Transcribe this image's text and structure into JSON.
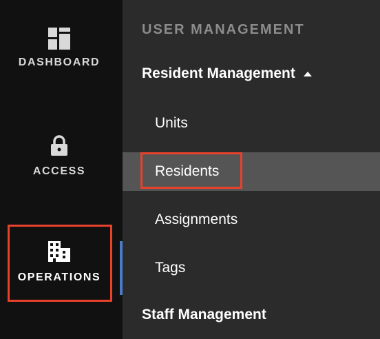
{
  "rail": {
    "items": [
      {
        "label": "DASHBOARD",
        "icon": "dashboard-icon"
      },
      {
        "label": "ACCESS",
        "icon": "lock-icon"
      },
      {
        "label": "OPERATIONS",
        "icon": "building-icon"
      }
    ],
    "active": "OPERATIONS"
  },
  "panel": {
    "section_title": "USER MANAGEMENT",
    "groups": [
      {
        "label": "Resident Management",
        "expanded": true,
        "items": [
          "Units",
          "Residents",
          "Assignments",
          "Tags"
        ],
        "selected": "Residents"
      },
      {
        "label": "Staff Management"
      }
    ]
  },
  "colors": {
    "rail_bg": "#111111",
    "panel_bg": "#2b2b2b",
    "selected_bg": "#555555",
    "highlight": "#e8412c",
    "active_indicator": "#4a7cc9"
  }
}
